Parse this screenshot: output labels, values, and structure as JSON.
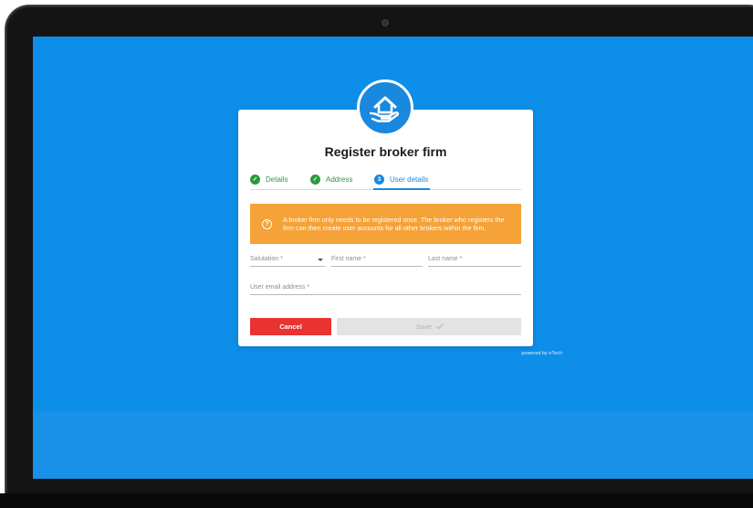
{
  "app": {
    "title": "Register broker firm",
    "logo_icon": "house-in-hand-icon"
  },
  "stepper": {
    "steps": [
      {
        "label": "Details",
        "state": "done",
        "marker": "✓"
      },
      {
        "label": "Address",
        "state": "done",
        "marker": "✓"
      },
      {
        "label": "User details",
        "state": "active",
        "marker": "3"
      }
    ]
  },
  "banner": {
    "icon": "help-circle-icon",
    "icon_glyph": "?",
    "text": "A broker firm only needs to be registered once. The broker who registers the firm can then create user accounts for all other brokers within the firm."
  },
  "form": {
    "salutation_placeholder": "Salutation *",
    "first_name_placeholder": "First name *",
    "last_name_placeholder": "Last name *",
    "email_placeholder": "User email address *"
  },
  "actions": {
    "cancel_label": "Cancel",
    "save_label": "Save"
  },
  "footer": {
    "powered_by": "powered by",
    "brand": "eTech"
  },
  "colors": {
    "screen_background": "#0d8ee8",
    "accent": "#1a88de",
    "success": "#2b9a3c",
    "warning_banner": "#f5a238",
    "danger": "#e83332"
  }
}
